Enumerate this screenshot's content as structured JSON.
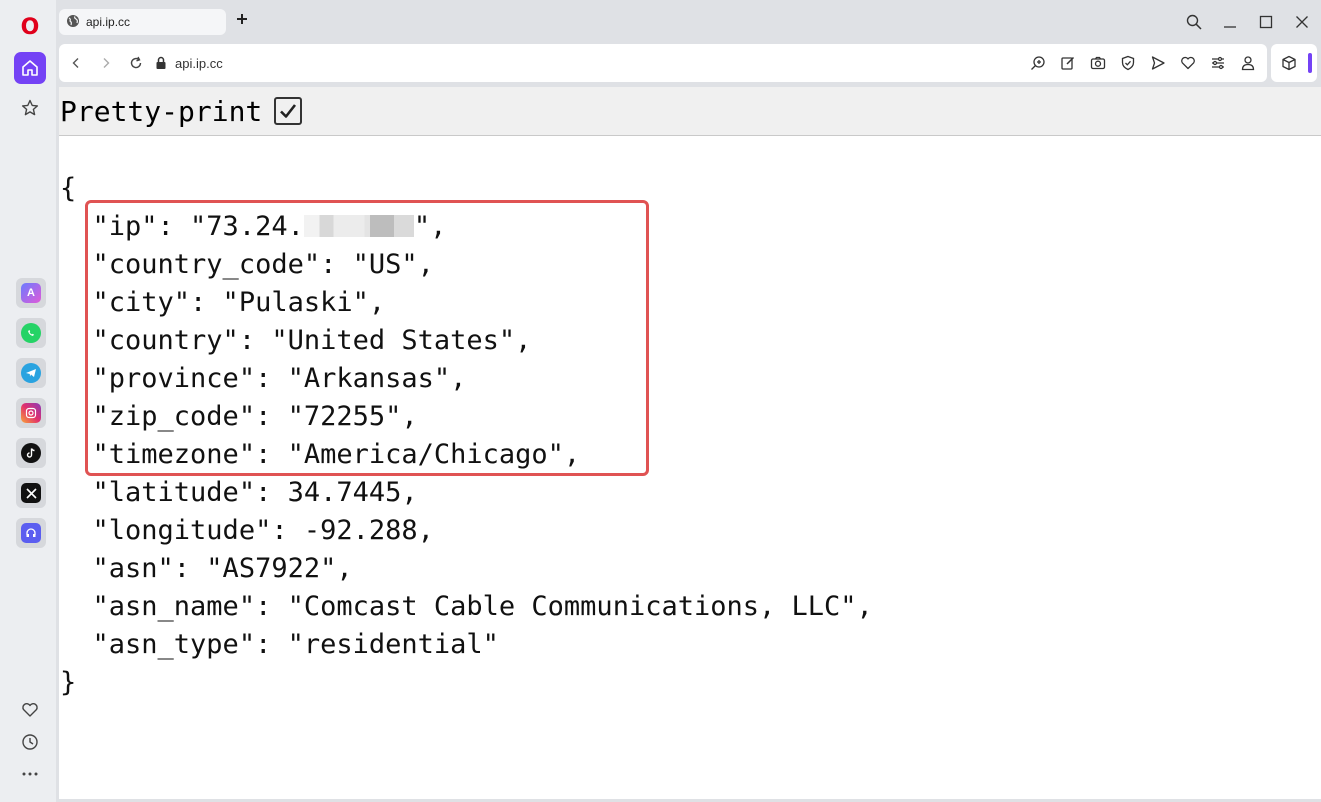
{
  "browser": {
    "tab_title": "api.ip.cc",
    "url": "api.ip.cc",
    "logo_letter": "O",
    "accent_color": "#7442f5"
  },
  "toolbar": {
    "pretty_print_label": "Pretty-print",
    "pretty_print_checked": true
  },
  "json_lines": {
    "open_brace": "{",
    "ip_prefix": "\"ip\": \"73.24.",
    "ip_suffix": "\",",
    "country_code": "\"country_code\": \"US\",",
    "city": "\"city\": \"Pulaski\",",
    "country": "\"country\": \"United States\",",
    "province": "\"province\": \"Arkansas\",",
    "zip_code": "\"zip_code\": \"72255\",",
    "timezone": "\"timezone\": \"America/Chicago\",",
    "latitude": "\"latitude\": 34.7445,",
    "longitude": "\"longitude\": -92.288,",
    "asn": "\"asn\": \"AS7922\",",
    "asn_name": "\"asn_name\": \"Comcast Cable Communications, LLC\",",
    "asn_type": "\"asn_type\": \"residential\"",
    "close_brace": "}"
  },
  "highlight_color": "#e05353"
}
